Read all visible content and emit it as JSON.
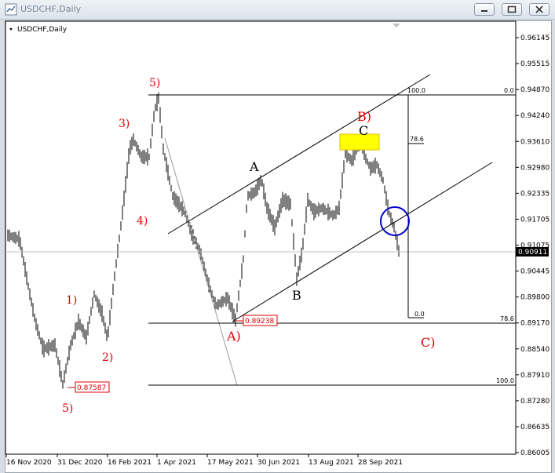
{
  "window": {
    "title": "USDCHF,Daily",
    "symbol_label": "USDCHF,Daily"
  },
  "chart_data": {
    "type": "line",
    "series": [],
    "x": [],
    "xlabel": "",
    "ylabel": "",
    "ylim": [
      0.86005,
      0.9661
    ],
    "x_ticks": [
      "16 Nov 2020",
      "31 Dec 2020",
      "16 Feb 2021",
      "1 Apr 2021",
      "17 May 2021",
      "30 Jun 2021",
      "13 Aug 2021",
      "28 Sep 2021"
    ],
    "y_ticks": [
      "0.96145",
      "0.95515",
      "0.94870",
      "0.94240",
      "0.93610",
      "0.92980",
      "0.92335",
      "0.91705",
      "0.91075",
      "0.90445",
      "0.89800",
      "0.89170",
      "0.88540",
      "0.87910",
      "0.87280",
      "0.86635",
      "0.86005"
    ],
    "current_price": "0.90911",
    "price_boxes": [
      "0.89238",
      "0.87587"
    ],
    "wave_labels": [
      "5)",
      "3)",
      "4)",
      "1)",
      "2)",
      "5)",
      "A)",
      "B)",
      "C)",
      "A",
      "B",
      "C"
    ],
    "fib_labels": [
      "100.0",
      "78.6",
      "0.0",
      "0.0",
      "78.6",
      "100.0"
    ],
    "colors": {
      "wave_red": "#e00000",
      "highlight": "#ffff00",
      "circle": "#0000cc"
    }
  }
}
